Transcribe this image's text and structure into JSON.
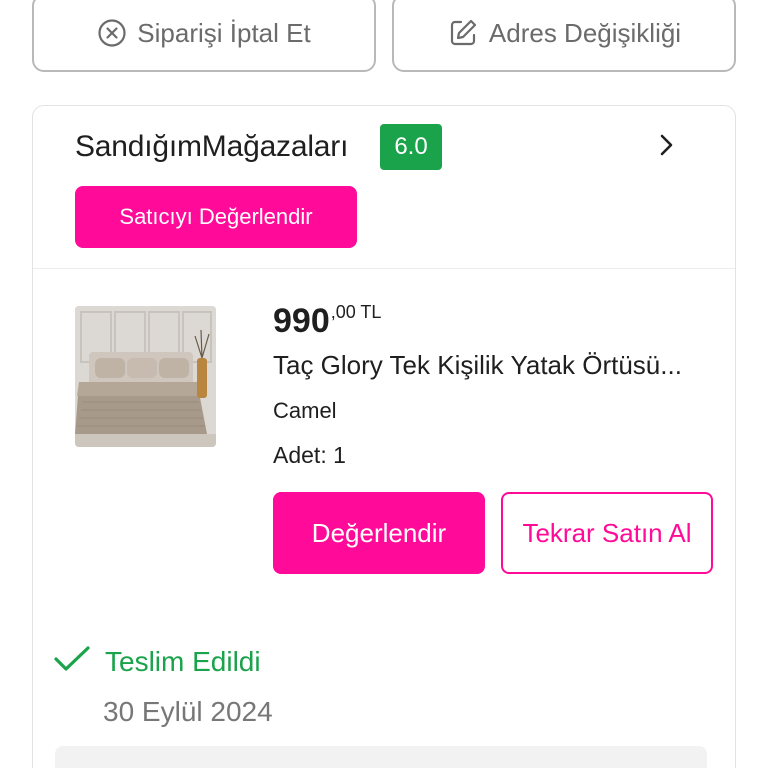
{
  "top_actions": {
    "cancel_label": "Siparişi İptal Et",
    "address_label": "Adres Değişikliği"
  },
  "seller": {
    "name": "SandığımMağazaları",
    "score": "6.0",
    "rate_button": "Satıcıyı Değerlendir",
    "score_color": "#1aa34a"
  },
  "product": {
    "price_main": "990",
    "price_decimal": ",00 TL",
    "title": "Taç Glory Tek Kişilik Yatak Örtüsü...",
    "variant": "Camel",
    "qty_label": "Adet: ",
    "qty_value": "1",
    "rate_button": "Değerlendir",
    "rebuy_button": "Tekrar Satın Al"
  },
  "delivery": {
    "status": "Teslim Edildi",
    "date": "30 Eylül 2024"
  },
  "colors": {
    "accent": "#ff0a99",
    "success": "#1aa34a"
  },
  "icons": {
    "cancel": "x-circle-icon",
    "edit": "edit-icon",
    "chevron": "chevron-right-icon",
    "check": "check-icon"
  }
}
